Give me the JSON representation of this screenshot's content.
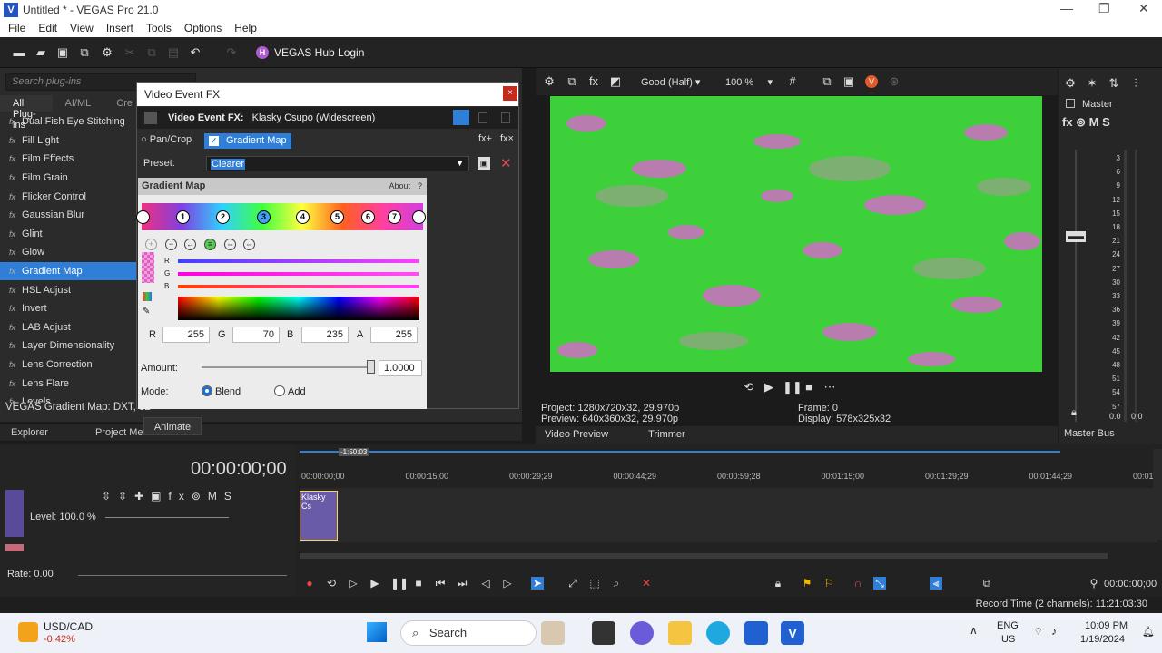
{
  "window": {
    "title": "Untitled * - VEGAS Pro 21.0",
    "app_letter": "V"
  },
  "menu": [
    "File",
    "Edit",
    "View",
    "Insert",
    "Tools",
    "Options",
    "Help"
  ],
  "toolbar": {
    "hub_label": "VEGAS Hub Login",
    "hub_icon": "H"
  },
  "plugins": {
    "search_placeholder": "Search plug-ins",
    "tabs": [
      "All Plug-ins",
      "AI/ML",
      "Cre"
    ],
    "items": [
      "Dual Fish Eye Stitching",
      "Fill Light",
      "Film Effects",
      "Film Grain",
      "Flicker Control",
      "Gaussian Blur",
      "Glint",
      "Glow",
      "Gradient Map",
      "HSL Adjust",
      "Invert",
      "LAB Adjust",
      "Layer Dimensionality",
      "Lens Correction",
      "Lens Flare",
      "Levels"
    ],
    "selected_index": 8,
    "status": "VEGAS Gradient Map: DXT, 32"
  },
  "bottom_tabs": [
    "Explorer",
    "Project Med"
  ],
  "dialog": {
    "title": "Video Event FX",
    "close": "×",
    "fx_title": "Video Event FX:",
    "fx_clip": "Klasky Csupo (Widescreen)",
    "chain": {
      "pancrop": "Pan/Crop",
      "gradient": "Gradient Map"
    },
    "preset_label": "Preset:",
    "preset_value": "Clearer",
    "panel_title": "Gradient Map",
    "about": "About",
    "about_q": "?",
    "stops": [
      "1",
      "2",
      "3",
      "4",
      "5",
      "6",
      "7"
    ],
    "rgb": {
      "r_label": "R",
      "g_label": "G",
      "b_label": "B",
      "r": "255",
      "g": "70",
      "b": "235",
      "a_label": "A",
      "a": "255"
    },
    "amount_label": "Amount:",
    "amount_value": "1.0000",
    "amount_fraction": 1.0,
    "mode_label": "Mode:",
    "mode_blend": "Blend",
    "mode_add": "Add"
  },
  "animate": "Animate",
  "preview": {
    "quality": "Good (Half)",
    "zoom": "100 %",
    "project": "Project:  1280x720x32, 29.970p",
    "preview_line": "Preview:  640x360x32, 29.970p",
    "frame": "Frame:   0",
    "display": "Display:  578x325x32",
    "tabs": [
      "Video Preview",
      "Trimmer"
    ]
  },
  "mixer": {
    "title": "Master",
    "scale": [
      "3",
      "6",
      "9",
      "12",
      "15",
      "18",
      "21",
      "24",
      "27",
      "30",
      "33",
      "36",
      "39",
      "42",
      "45",
      "48",
      "51",
      "54",
      "57"
    ],
    "left_val": "0.0",
    "right_val": "0.0",
    "footer": "Master Bus"
  },
  "timeline": {
    "timecode": "00:00:00;00",
    "marker": "-1:50:03",
    "level": "Level: 100.0 %",
    "rate": "Rate: 0.00",
    "ruler": [
      "00:00:00;00",
      "00:00:15;00",
      "00:00:29;29",
      "00:00:44;29",
      "00:00:59;28",
      "00:01:15;00",
      "00:01:29;29",
      "00:01:44;29",
      "00:01:5"
    ],
    "clip_label": "Klasky Cs",
    "end_time": "00:00:00;00"
  },
  "status": {
    "record": "Record Time (2 channels): 11:21:03:30"
  },
  "taskbar": {
    "ticker": "USD/CAD",
    "change": "-0.42%",
    "search": "Search",
    "lang": "ENG",
    "region": "US",
    "time": "10:09 PM",
    "date": "1/19/2024"
  }
}
